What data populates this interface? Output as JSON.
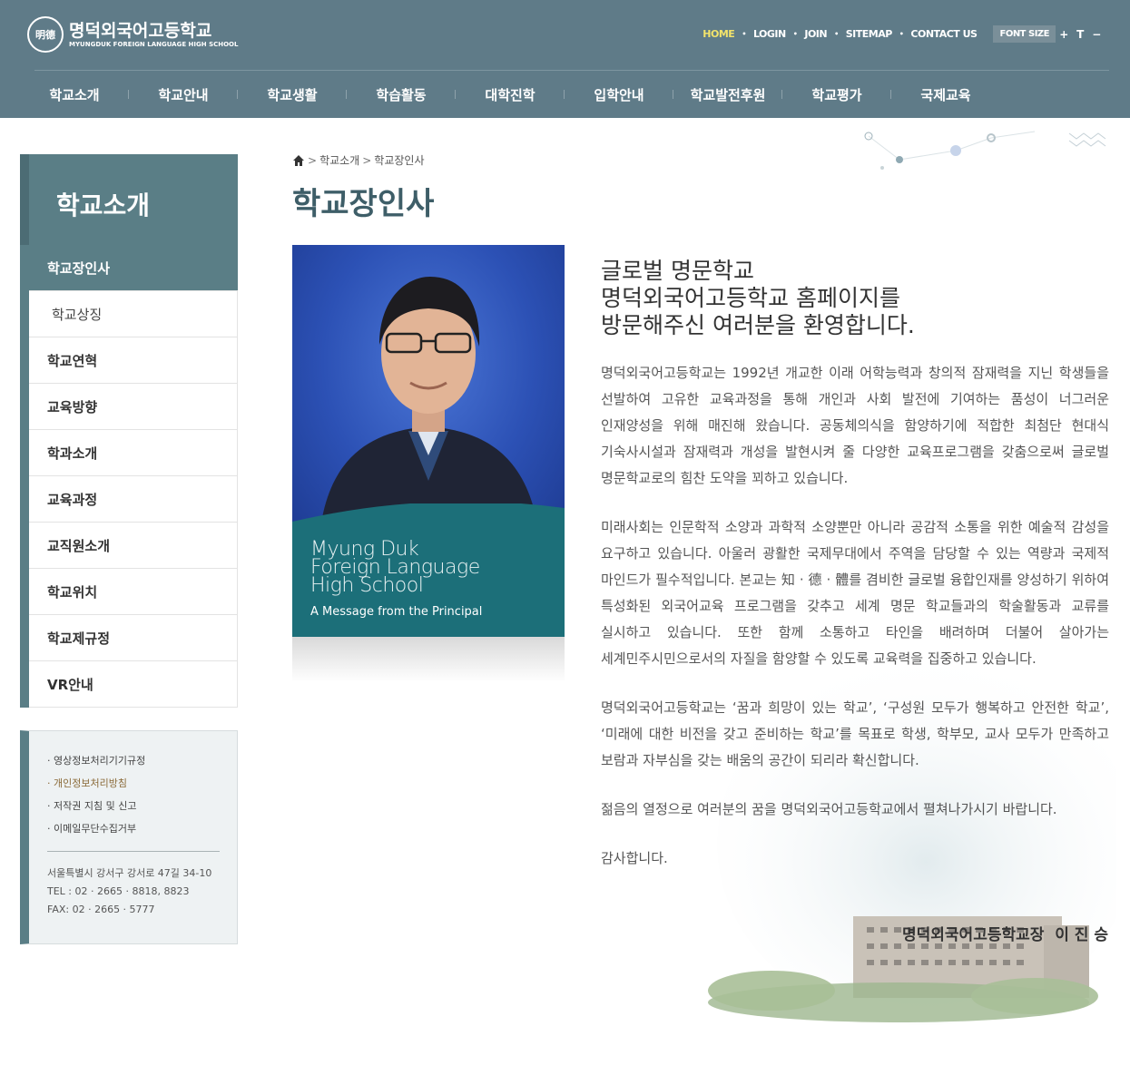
{
  "header": {
    "logo": {
      "emblem_text": "明德",
      "name_kr": "명덕외국어고등학교",
      "name_en": "MYUNGDUK FOREIGN LANGUAGE HIGH SCHOOL"
    },
    "util_links": [
      "HOME",
      "LOGIN",
      "JOIN",
      "SITEMAP",
      "CONTACT US"
    ],
    "font_size_label": "FONT SIZE",
    "font_buttons": [
      "+",
      "T",
      "−"
    ]
  },
  "gnb": [
    "학교소개",
    "학교안내",
    "학교생활",
    "학습활동",
    "대학진학",
    "입학안내",
    "학교발전후원",
    "학교평가",
    "국제교육"
  ],
  "sidebar": {
    "title": "학교소개",
    "items": [
      "학교장인사",
      "학교상징",
      "학교연혁",
      "교육방향",
      "학과소개",
      "교육과정",
      "교직원소개",
      "학교위치",
      "학교제규정",
      "VR안내"
    ],
    "links": [
      "· 영상정보처리기기규정",
      "· 개인정보처리방침",
      "· 저작권 지침 및 신고",
      "· 이메일무단수집거부"
    ],
    "address": "서울특별시 강서구 강서로 47길 34-10",
    "tel": "TEL : 02 · 2665 · 8818, 8823",
    "fax": "FAX: 02 · 2665 · 5777"
  },
  "breadcrumb": [
    "학교소개",
    "학교장인사"
  ],
  "page_title": "학교장인사",
  "portrait": {
    "en_line1": "Myung Duk",
    "en_line2": "Foreign Language",
    "en_line3": "High School",
    "message": "A Message from the Principal"
  },
  "greeting": {
    "head1": "글로벌 명문학교",
    "head2": "명덕외국어고등학교 홈페이지를",
    "head3": "방문해주신 여러분을 환영합니다.",
    "p1": "명덕외국어고등학교는 1992년 개교한 이래 어학능력과 창의적 잠재력을 지닌 학생들을 선발하여 고유한 교육과정을 통해 개인과 사회 발전에 기여하는 품성이 너그러운 인재양성을 위해 매진해 왔습니다. 공동체의식을 함양하기에 적합한 최첨단 현대식 기숙사시설과 잠재력과 개성을 발현시켜 줄 다양한 교육프로그램을 갖춤으로써 글로벌 명문학교로의 힘찬 도약을 꾀하고 있습니다.",
    "p2": "미래사회는 인문학적 소양과 과학적 소양뿐만 아니라 공감적 소통을 위한 예술적 감성을 요구하고 있습니다. 아울러 광활한 국제무대에서 주역을 담당할 수 있는 역량과 국제적 마인드가 필수적입니다. 본교는 知 · 德 · 體를 겸비한 글로벌 융합인재를 양성하기 위하여 특성화된 외국어교육 프로그램을 갖추고 세계 명문 학교들과의 학술활동과 교류를 실시하고 있습니다. 또한 함께 소통하고 타인을 배려하며 더불어 살아가는 세계민주시민으로서의 자질을 함양할 수 있도록 교육력을 집중하고 있습니다.",
    "p3": "명덕외국어고등학교는 ‘꿈과 희망이 있는 학교’, ‘구성원 모두가 행복하고 안전한 학교’, ‘미래에 대한 비전을 갖고 준비하는 학교’를 목표로 학생, 학부모, 교사 모두가 만족하고 보람과 자부심을 갖는 배움의 공간이 되리라 확신합니다.",
    "p4": "젊음의 열정으로 여러분의 꿈을 명덕외국어고등학교에서 펼쳐나가시기 바랍니다.",
    "p5": "감사합니다.",
    "signature": "명덕외국어고등학교장  이 진 승"
  }
}
